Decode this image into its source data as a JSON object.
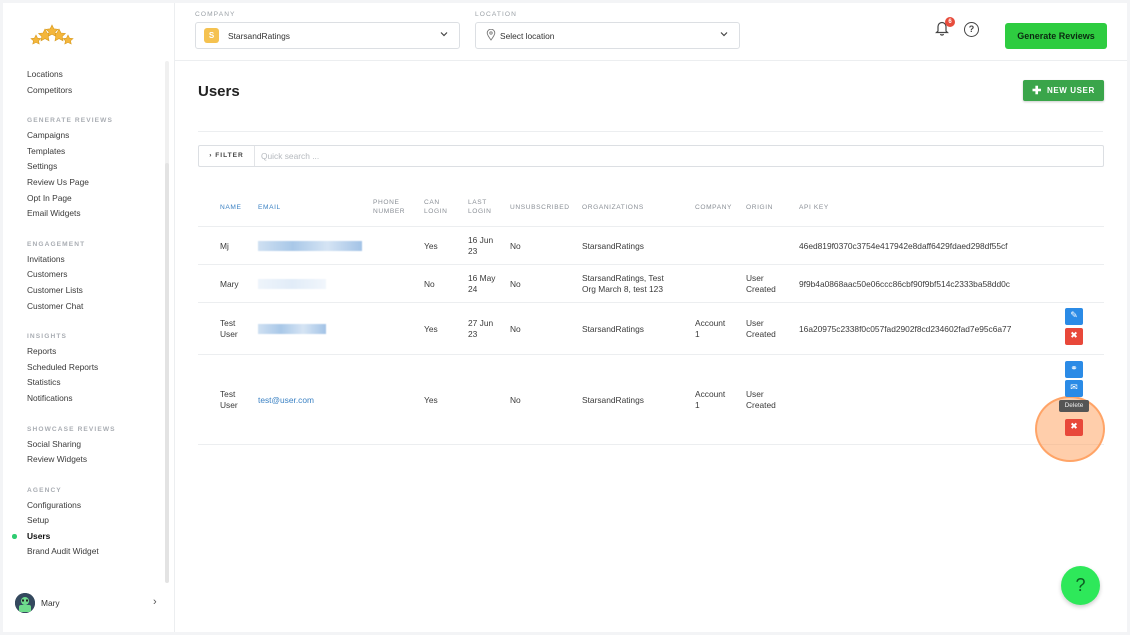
{
  "sidebar": {
    "groups": [
      {
        "title": "",
        "items": [
          "Locations",
          "Competitors"
        ]
      },
      {
        "title": "GENERATE REVIEWS",
        "items": [
          "Campaigns",
          "Templates",
          "Settings",
          "Review Us Page",
          "Opt In Page",
          "Email Widgets"
        ]
      },
      {
        "title": "ENGAGEMENT",
        "items": [
          "Invitations",
          "Customers",
          "Customer Lists",
          "Customer Chat"
        ]
      },
      {
        "title": "INSIGHTS",
        "items": [
          "Reports",
          "Scheduled Reports",
          "Statistics",
          "Notifications"
        ]
      },
      {
        "title": "SHOWCASE REVIEWS",
        "items": [
          "Social Sharing",
          "Review Widgets"
        ]
      },
      {
        "title": "AGENCY",
        "items": [
          "Configurations",
          "Setup",
          "Users",
          "Brand Audit Widget"
        ]
      }
    ],
    "active_item": "Users",
    "user_name": "Mary",
    "accent": "#2ecc71"
  },
  "topbar": {
    "company_label": "COMPANY",
    "company_value": "StarsandRatings",
    "company_initial": "S",
    "location_label": "LOCATION",
    "location_placeholder": "Select location",
    "notification_count": "6",
    "help_glyph": "?",
    "generate_label": "Generate Reviews"
  },
  "page": {
    "title": "Users",
    "new_user_label": "NEW USER",
    "filter_label": "FILTER",
    "search_placeholder": "Quick search ..."
  },
  "table": {
    "columns": [
      "NAME",
      "EMAIL",
      "PHONE\nNUMBER",
      "CAN\nLOGIN",
      "LAST\nLOGIN",
      "UNSUBSCRIBED",
      "ORGANIZATIONS",
      "COMPANY",
      "ORIGIN",
      "API KEY"
    ],
    "rows": [
      {
        "name": "Mj",
        "email": "",
        "phone": "",
        "can_login": "Yes",
        "last_login": "16 Jun\n23",
        "unsubscribed": "No",
        "organizations": "StarsandRatings",
        "company": "",
        "origin": "",
        "api_key": "46ed819f0370c3754e417942e8daff6429fdaed298df55cf"
      },
      {
        "name": "Mary",
        "email": "",
        "phone": "",
        "can_login": "No",
        "last_login": "16 May\n24",
        "unsubscribed": "No",
        "organizations": "StarsandRatings, Test\nOrg March 8, test 123",
        "company": "",
        "origin": "User\nCreated",
        "api_key": "9f9b4a0868aac50e06ccc86cbf90f9bf514c2333ba58dd0c"
      },
      {
        "name": "Test\nUser",
        "email": "",
        "phone": "",
        "can_login": "Yes",
        "last_login": "27 Jun\n23",
        "unsubscribed": "No",
        "organizations": "StarsandRatings",
        "company": "Account\n1",
        "origin": "User\nCreated",
        "api_key": "16a20975c2338f0c057fad2902f8cd234602fad7e95c6a77"
      },
      {
        "name": "Test\nUser",
        "email": "test@user.com",
        "phone": "",
        "can_login": "Yes",
        "last_login": "",
        "unsubscribed": "No",
        "organizations": "StarsandRatings",
        "company": "Account\n1",
        "origin": "User\nCreated",
        "api_key": ""
      }
    ]
  },
  "actions": {
    "edit_icon": "pencil-icon",
    "delete_icon": "x-icon",
    "link_icon": "link-icon",
    "mail_icon": "mail-icon",
    "tooltip_delete": "Delete"
  },
  "help_fab": "?"
}
